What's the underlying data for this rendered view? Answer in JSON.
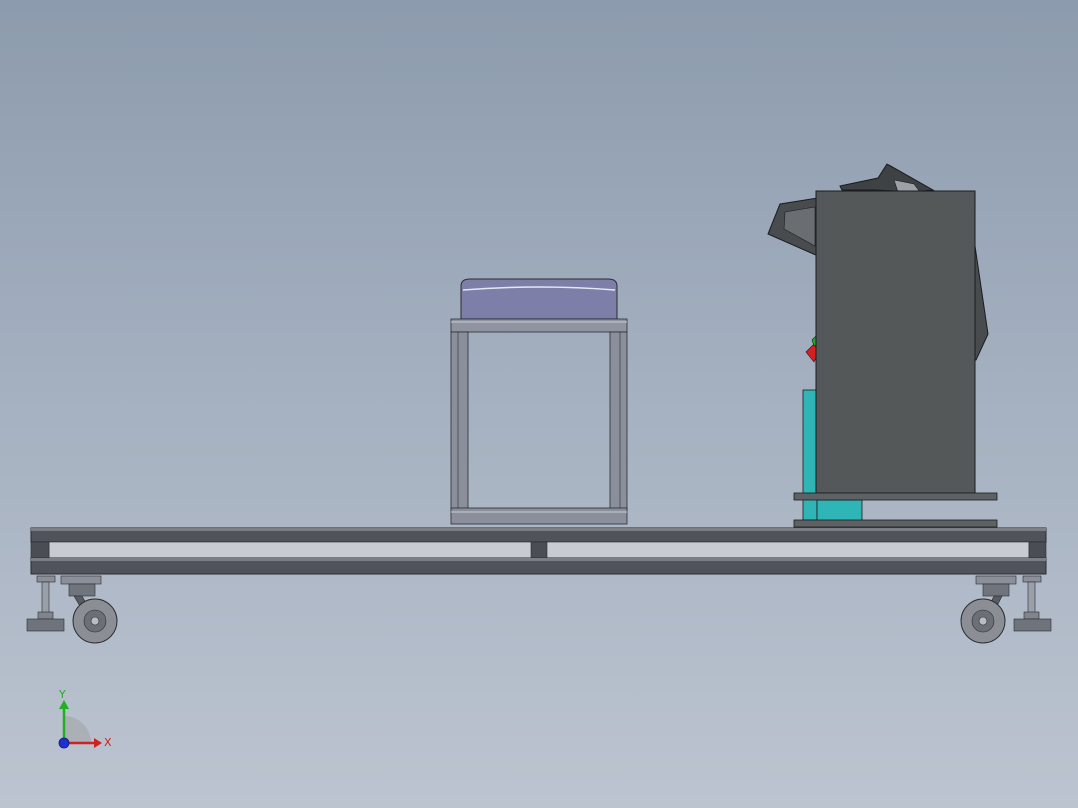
{
  "viewport": {
    "background_top": "#8c9bad",
    "background_bottom": "#bcc4d0"
  },
  "colors": {
    "frame": "#4a4e54",
    "frame_light": "#6b7077",
    "stand_top": "#7d7fa8",
    "stand_leg": "#8a8f9b",
    "machine_body": "#545859",
    "machine_dark": "#3e4244",
    "cyan_part": "#2fb5b5",
    "red_part": "#d42020",
    "green_part": "#22aa22",
    "wheel": "#8c8e96",
    "axis_x": "#d02020",
    "axis_y": "#20b020",
    "axis_z": "#2030d0"
  },
  "triad": {
    "x_label": "X",
    "y_label": "Y"
  }
}
